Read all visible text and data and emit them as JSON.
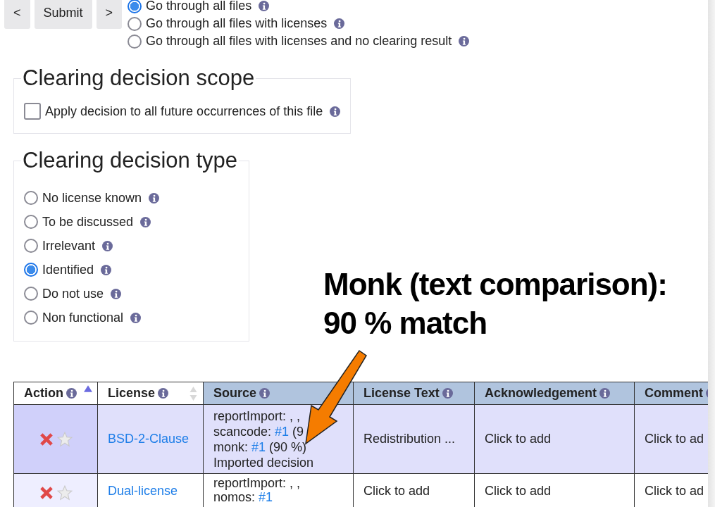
{
  "nav_buttons": [
    "<",
    "Submit",
    ">"
  ],
  "navigation_options": [
    {
      "label": "Go through all files",
      "selected": true
    },
    {
      "label": "Go through all files with licenses",
      "selected": false
    },
    {
      "label": "Go through all files with licenses and no clearing result",
      "selected": false
    }
  ],
  "scope": {
    "legend": "Clearing decision scope",
    "options": [
      {
        "label": "Apply decision to all future occurrences of this file",
        "checked": false
      }
    ]
  },
  "decision_type": {
    "legend": "Clearing decision type",
    "options": [
      {
        "label": "No license known",
        "selected": false
      },
      {
        "label": "To be discussed",
        "selected": false
      },
      {
        "label": "Irrelevant",
        "selected": false
      },
      {
        "label": "Identified",
        "selected": true
      },
      {
        "label": "Do not use",
        "selected": false
      },
      {
        "label": "Non functional",
        "selected": false
      }
    ]
  },
  "annotation": {
    "lines": [
      "Monk (text comparison):",
      "90 % match"
    ]
  },
  "table": {
    "columns": [
      {
        "label": "Action",
        "sortable": true,
        "sorted": true
      },
      {
        "label": "License",
        "sortable": true,
        "sorted": false
      },
      {
        "label": "Source"
      },
      {
        "label": "License Text"
      },
      {
        "label": "Acknowledgement"
      },
      {
        "label": "Comment"
      }
    ],
    "rows": [
      {
        "selected": true,
        "license": "BSD-2-Clause",
        "source": [
          {
            "prefix": "reportImport: , ,"
          },
          {
            "prefix": "scancode: ",
            "link": "#1",
            "suffix": " (9"
          },
          {
            "prefix": "monk: ",
            "link": "#1",
            "suffix": " (90 %)"
          },
          {
            "prefix": "Imported decision"
          }
        ],
        "license_text": "Redistribution ...",
        "acknowledgement": "Click to add",
        "comment": "Click to ad"
      },
      {
        "selected": false,
        "license": "Dual-license",
        "source": [
          {
            "prefix": "reportImport: , ,"
          },
          {
            "prefix": "nomos: ",
            "link": "#1"
          }
        ],
        "license_text": "Click to add",
        "acknowledgement": "Click to add",
        "comment": "Click to ad"
      }
    ]
  }
}
